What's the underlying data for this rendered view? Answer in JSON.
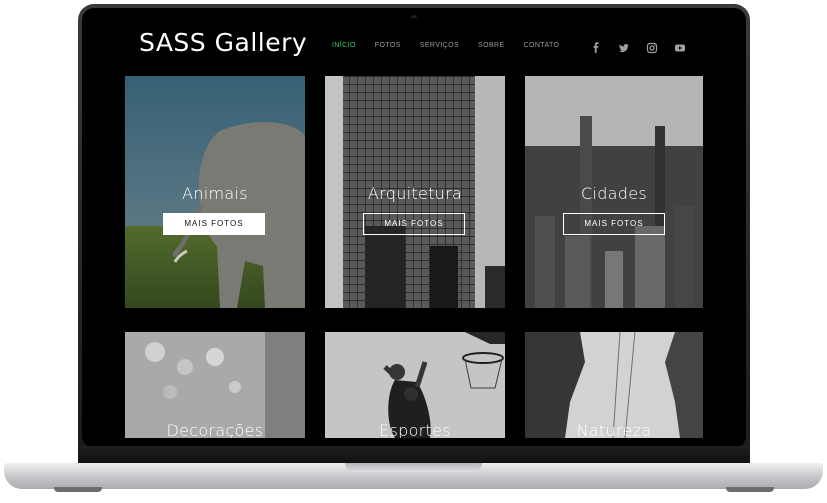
{
  "site": {
    "logo": "SASS Gallery",
    "nav": [
      {
        "label": "INÍCIO",
        "active": true
      },
      {
        "label": "FOTOS",
        "active": false
      },
      {
        "label": "SERVIÇOS",
        "active": false
      },
      {
        "label": "SOBRE",
        "active": false
      },
      {
        "label": "CONTATO",
        "active": false
      }
    ],
    "social_icons": [
      "facebook-icon",
      "twitter-icon",
      "instagram-icon",
      "youtube-icon"
    ]
  },
  "gallery": {
    "button_label": "MAIS FOTOS",
    "cards": [
      {
        "title": "Animais"
      },
      {
        "title": "Arquitetura"
      },
      {
        "title": "Cidades"
      },
      {
        "title": "Decorações"
      },
      {
        "title": "Esportes"
      },
      {
        "title": "Natureza"
      }
    ]
  },
  "colors": {
    "accent": "#2ecc71",
    "background": "#000000"
  }
}
